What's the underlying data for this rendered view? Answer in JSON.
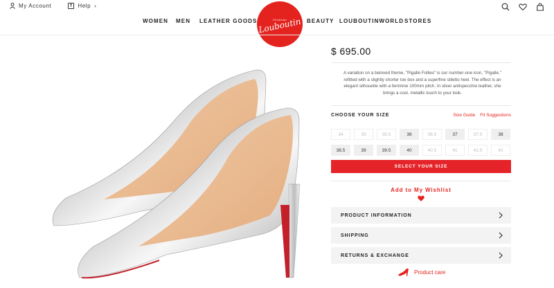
{
  "utility": {
    "account_label": "My Account",
    "help_label": "Help",
    "help_caret": "›",
    "facebook_letter": "f"
  },
  "nav": {
    "items": [
      "WOMEN",
      "MEN",
      "LEATHER GOODS",
      "BEAUTY",
      "LOUBOUTINWORLD",
      "STORES"
    ]
  },
  "logo": {
    "top_text": "Christian",
    "script_text": "Louboutin"
  },
  "product": {
    "price": "$ 695.00",
    "description": "A variation on a beloved theme, \"Pigalle Follies\" is our number-one icon, \"Pigalle,\" refitted with a slightly shorter toe box and a superfine stiletto heel. The effect is an elegant silhouette with a feminine 100mm pitch. In silver antispecchio leather, she brings a cool, metallic touch to your look."
  },
  "sizes": {
    "title": "CHOOSE YOUR SIZE",
    "guide_label": "Size Guide",
    "fit_label": "Fit Suggestions",
    "options": [
      {
        "label": "34",
        "available": false
      },
      {
        "label": "35",
        "available": false
      },
      {
        "label": "35.5",
        "available": false
      },
      {
        "label": "36",
        "available": true
      },
      {
        "label": "36.5",
        "available": false
      },
      {
        "label": "37",
        "available": true
      },
      {
        "label": "37.5",
        "available": false
      },
      {
        "label": "38",
        "available": true
      },
      {
        "label": "38.5",
        "available": true
      },
      {
        "label": "39",
        "available": true
      },
      {
        "label": "39.5",
        "available": true
      },
      {
        "label": "40",
        "available": true
      },
      {
        "label": "40.5",
        "available": false
      },
      {
        "label": "41",
        "available": false
      },
      {
        "label": "41.5",
        "available": false
      },
      {
        "label": "42",
        "available": false
      }
    ],
    "select_label": "SELECT YOUR SIZE"
  },
  "wishlist_label": "Add to My Wishlist",
  "accordion": {
    "product_info": "PRODUCT INFORMATION",
    "shipping": "SHIPPING",
    "returns": "RETURNS & EXCHANGE"
  },
  "care_label": "Product care",
  "colors": {
    "accent": "#e4231f",
    "button_red": "#e5242a"
  }
}
